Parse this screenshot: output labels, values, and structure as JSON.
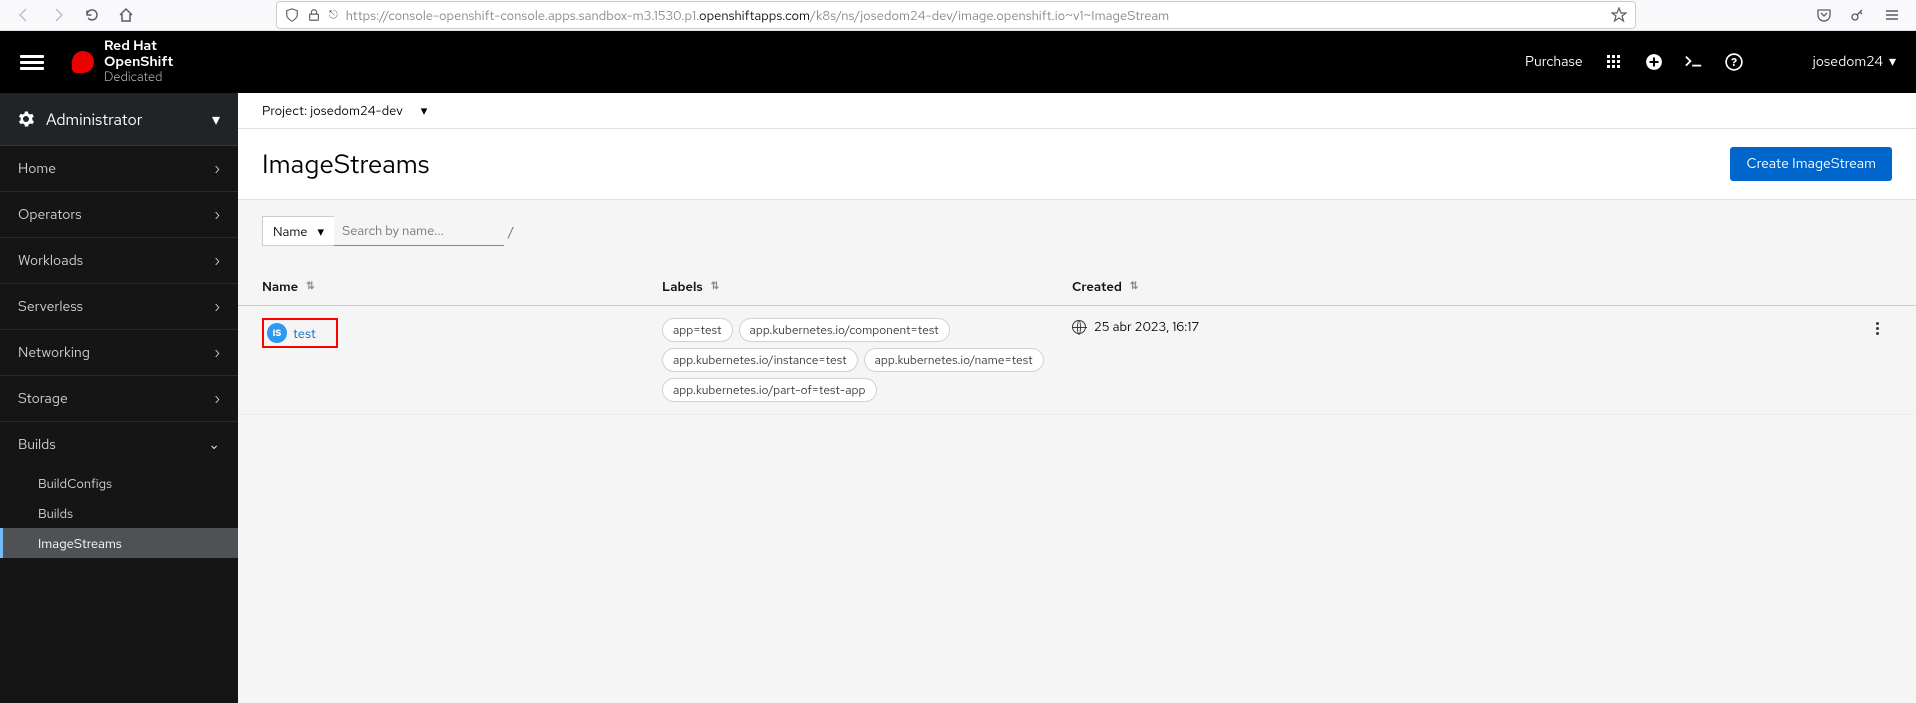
{
  "browser": {
    "url_prefix": "https://console-openshift-console.apps.sandbox-m3.1530.p1.",
    "url_bold": "openshiftapps.com",
    "url_suffix": "/k8s/ns/josedom24-dev/image.openshift.io~v1~ImageStream"
  },
  "masthead": {
    "brand_line1": "Red Hat",
    "brand_line2": "OpenShift",
    "brand_line3": "Dedicated",
    "purchase": "Purchase",
    "user": "josedom24"
  },
  "sidebar": {
    "perspective": "Administrator",
    "items": [
      "Home",
      "Operators",
      "Workloads",
      "Serverless",
      "Networking",
      "Storage",
      "Builds"
    ],
    "build_subs": [
      "BuildConfigs",
      "Builds",
      "ImageStreams"
    ]
  },
  "project": {
    "label": "Project:",
    "name": "josedom24-dev"
  },
  "page": {
    "title": "ImageStreams",
    "create_btn": "Create ImageStream",
    "filter_name": "Name",
    "search_placeholder": "Search by name...",
    "slash": "/"
  },
  "table": {
    "col_name": "Name",
    "col_labels": "Labels",
    "col_created": "Created",
    "rows": [
      {
        "name": "test",
        "badge": "IS",
        "labels": [
          "app=test",
          "app.kubernetes.io/component=test",
          "app.kubernetes.io/instance=test",
          "app.kubernetes.io/name=test",
          "app.kubernetes.io/part-of=test-app"
        ],
        "created": "25 abr 2023, 16:17"
      }
    ]
  }
}
